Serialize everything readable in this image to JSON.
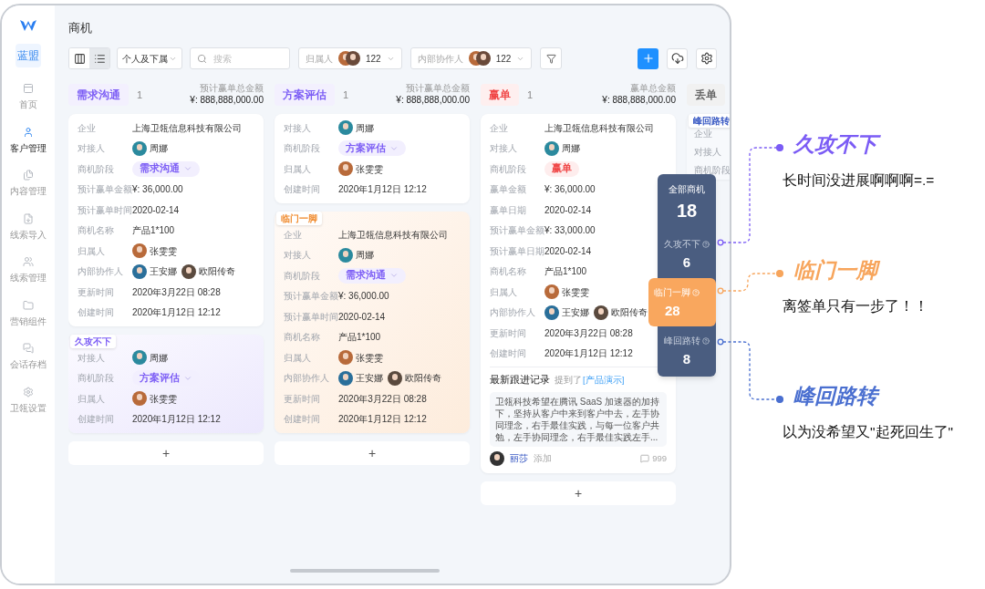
{
  "sidebar": {
    "brand": "蓝盟",
    "items": [
      {
        "label": "首页",
        "selected": false
      },
      {
        "label": "客户管理",
        "selected": true
      },
      {
        "label": "内容管理",
        "selected": false
      },
      {
        "label": "线索导入",
        "selected": false
      },
      {
        "label": "线索管理",
        "selected": false
      },
      {
        "label": "营销组件",
        "selected": false
      },
      {
        "label": "会话存档",
        "selected": false
      },
      {
        "label": "卫瓴设置",
        "selected": false
      }
    ]
  },
  "page_title": "商机",
  "toolbar": {
    "views": [
      {
        "kind": "board",
        "selected": false
      },
      {
        "kind": "list",
        "selected": true
      }
    ],
    "scope": "个人及下属",
    "search": {
      "placeholder": "搜索"
    },
    "filters": [
      {
        "label": "归属人",
        "count": "122"
      },
      {
        "label": "内部协作人",
        "count": "122"
      }
    ]
  },
  "columns": [
    {
      "stage": "需求沟通",
      "color": "#7b5cf5",
      "count": "1",
      "total_label": "预计赢单总金额",
      "total": "¥: 888,888,000.00",
      "cards": [
        {
          "fields": [
            {
              "label": "企业",
              "kind": "text",
              "value": "上海卫瓴信息科技有限公司"
            },
            {
              "label": "对接人",
              "kind": "people",
              "people": [
                {
                  "name": "周娜",
                  "color": "#2b8a9e"
                }
              ]
            },
            {
              "label": "商机阶段",
              "kind": "stage",
              "value": "需求沟通",
              "color": "#7b5cf5",
              "dropdown": true
            },
            {
              "label": "预计赢单金额",
              "kind": "text",
              "value": "¥: 36,000.00"
            },
            {
              "label": "预计赢单时间",
              "kind": "text",
              "value": "2020-02-14"
            },
            {
              "label": "商机名称",
              "kind": "text",
              "value": "产品1*100"
            },
            {
              "label": "归属人",
              "kind": "people",
              "people": [
                {
                  "name": "张雯雯",
                  "color": "#b86a3a"
                }
              ]
            },
            {
              "label": "内部协作人",
              "kind": "people",
              "people": [
                {
                  "name": "王安娜",
                  "color": "#2a6f9a"
                },
                {
                  "name": "欧阳传奇",
                  "color": "#5a4a3e"
                }
              ]
            },
            {
              "label": "更新时间",
              "kind": "text",
              "value": "2020年3月22日 08:28"
            },
            {
              "label": "创建时间",
              "kind": "text",
              "value": "2020年1月12日 12:12"
            }
          ]
        },
        {
          "tag": {
            "label": "久攻不下",
            "kind": "stalled"
          },
          "fields": [
            {
              "label": "对接人",
              "kind": "people",
              "people": [
                {
                  "name": "周娜",
                  "color": "#2b8a9e"
                }
              ]
            },
            {
              "label": "商机阶段",
              "kind": "stage",
              "value": "方案评估",
              "color": "#7b5cf5",
              "dropdown": true
            },
            {
              "label": "归属人",
              "kind": "people",
              "people": [
                {
                  "name": "张雯雯",
                  "color": "#b86a3a"
                }
              ]
            },
            {
              "label": "创建时间",
              "kind": "text",
              "value": "2020年1月12日 12:12"
            }
          ]
        }
      ],
      "add": "+"
    },
    {
      "stage": "方案评估",
      "color": "#7b5cf5",
      "count": "1",
      "total_label": "预计赢单总金额",
      "total": "¥: 888,888,000.00",
      "cards": [
        {
          "fields": [
            {
              "label": "对接人",
              "kind": "people",
              "people": [
                {
                  "name": "周娜",
                  "color": "#2b8a9e"
                }
              ]
            },
            {
              "label": "商机阶段",
              "kind": "stage",
              "value": "方案评估",
              "color": "#7b5cf5",
              "dropdown": true
            },
            {
              "label": "归属人",
              "kind": "people",
              "people": [
                {
                  "name": "张雯雯",
                  "color": "#b86a3a"
                }
              ]
            },
            {
              "label": "创建时间",
              "kind": "text",
              "value": "2020年1月12日 12:12"
            }
          ]
        },
        {
          "tag": {
            "label": "临门一脚",
            "kind": "closing"
          },
          "fields": [
            {
              "label": "企业",
              "kind": "text",
              "value": "上海卫瓴信息科技有限公司"
            },
            {
              "label": "对接人",
              "kind": "people",
              "people": [
                {
                  "name": "周娜",
                  "color": "#2b8a9e"
                }
              ]
            },
            {
              "label": "商机阶段",
              "kind": "stage",
              "value": "需求沟通",
              "color": "#7b5cf5",
              "dropdown": true
            },
            {
              "label": "预计赢单金额",
              "kind": "text",
              "value": "¥: 36,000.00"
            },
            {
              "label": "预计赢单时间",
              "kind": "text",
              "value": "2020-02-14"
            },
            {
              "label": "商机名称",
              "kind": "text",
              "value": "产品1*100"
            },
            {
              "label": "归属人",
              "kind": "people",
              "people": [
                {
                  "name": "张雯雯",
                  "color": "#b86a3a"
                }
              ]
            },
            {
              "label": "内部协作人",
              "kind": "people",
              "people": [
                {
                  "name": "王安娜",
                  "color": "#2a6f9a"
                },
                {
                  "name": "欧阳传奇",
                  "color": "#5a4a3e"
                }
              ]
            },
            {
              "label": "更新时间",
              "kind": "text",
              "value": "2020年3月22日 08:28"
            },
            {
              "label": "创建时间",
              "kind": "text",
              "value": "2020年1月12日 12:12"
            }
          ]
        }
      ],
      "add": "+"
    },
    {
      "stage": "赢单",
      "color": "#f04848",
      "count": "1",
      "total_label": "赢单总金额",
      "total": "¥: 888,888,000.00",
      "cards": [
        {
          "fields": [
            {
              "label": "企业",
              "kind": "text",
              "value": "上海卫瓴信息科技有限公司"
            },
            {
              "label": "对接人",
              "kind": "people",
              "people": [
                {
                  "name": "周娜",
                  "color": "#2b8a9e"
                }
              ]
            },
            {
              "label": "商机阶段",
              "kind": "stage",
              "value": "赢单",
              "color": "#f04848",
              "dropdown": false
            },
            {
              "label": "赢单金额",
              "kind": "text",
              "value": "¥: 36,000.00"
            },
            {
              "label": "赢单日期",
              "kind": "text",
              "value": "2020-02-14"
            },
            {
              "label": "预计赢单金额",
              "kind": "text",
              "value": "¥: 33,000.00"
            },
            {
              "label": "预计赢单日期",
              "kind": "text",
              "value": "2020-02-14"
            },
            {
              "label": "商机名称",
              "kind": "text",
              "value": "产品1*100"
            },
            {
              "label": "归属人",
              "kind": "people",
              "people": [
                {
                  "name": "张雯雯",
                  "color": "#b86a3a"
                }
              ]
            },
            {
              "label": "内部协作人",
              "kind": "people",
              "people": [
                {
                  "name": "王安娜",
                  "color": "#2a6f9a"
                },
                {
                  "name": "欧阳传奇",
                  "color": "#5a4a3e"
                }
              ]
            },
            {
              "label": "更新时间",
              "kind": "text",
              "value": "2020年3月22日 08:28"
            },
            {
              "label": "创建时间",
              "kind": "text",
              "value": "2020年1月12日 12:12"
            }
          ],
          "followup": {
            "title": "最新跟进记录",
            "mention_prefix": "提到了",
            "mention": "[产品演示]",
            "text": "卫瓴科技希望在腾讯 SaaS 加速器的加持下，坚持从客户中来到客户中去，左手协同理念，右手最佳实践，与每一位客户共勉，左手协同理念，右手最佳实践左手...",
            "author": "丽莎",
            "action": "添加",
            "comments": "999"
          }
        }
      ],
      "add": "+"
    },
    {
      "stage": "丢单",
      "color": "#666666",
      "cards": [
        {
          "tag": {
            "label": "峰回路转",
            "kind": "revived"
          },
          "fields": [
            {
              "label": "企业",
              "kind": "label"
            },
            {
              "label": "对接人",
              "kind": "label"
            },
            {
              "label": "商机阶段",
              "kind": "label"
            }
          ]
        }
      ]
    }
  ],
  "stats": {
    "title": "全部商机",
    "total": "18",
    "groups": [
      {
        "label": "久攻不下",
        "value": "6",
        "selected": false
      },
      {
        "label": "临门一脚",
        "value": "28",
        "selected": true
      },
      {
        "label": "峰回路转",
        "value": "8",
        "selected": false
      }
    ]
  },
  "annotations": [
    {
      "title": "久攻不下",
      "text": "长时间没进展啊啊啊=.=",
      "color": "#7b5cf5"
    },
    {
      "title": "临门一脚",
      "text": "离签单只有一步了！！",
      "color": "#f7a55c"
    },
    {
      "title": "峰回路转",
      "text": "以为没希望又\"起死回生了\"",
      "color": "#4a6fd0"
    }
  ]
}
